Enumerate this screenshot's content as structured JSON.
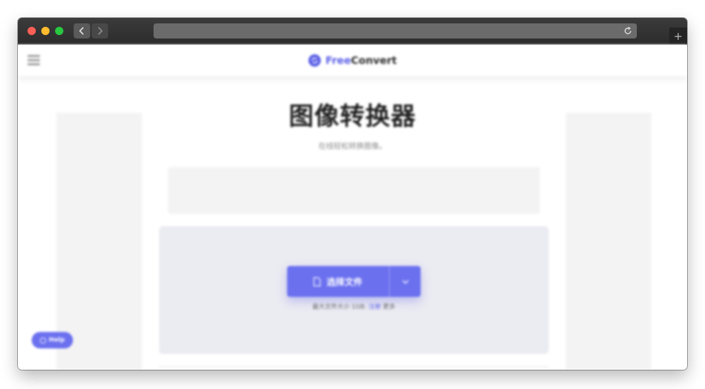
{
  "browser": {
    "url": "",
    "icons": {
      "back": "chevron-left-icon",
      "forward": "chevron-right-icon",
      "reload": "reload-icon",
      "new_tab": "plus-icon"
    }
  },
  "site": {
    "brand_free": "Free",
    "brand_convert": "Convert",
    "brand_color": "#5b5fe6",
    "menu_icon": "hamburger-menu-icon"
  },
  "main": {
    "title": "图像转换器",
    "subtitle": "在线轻松转换图像。",
    "choose_files_label": "选择文件",
    "drop_hint_prefix": "最大文件大小 1GB.",
    "drop_hint_link": "注册",
    "drop_hint_suffix": "更多"
  },
  "help": {
    "label": "Help"
  }
}
